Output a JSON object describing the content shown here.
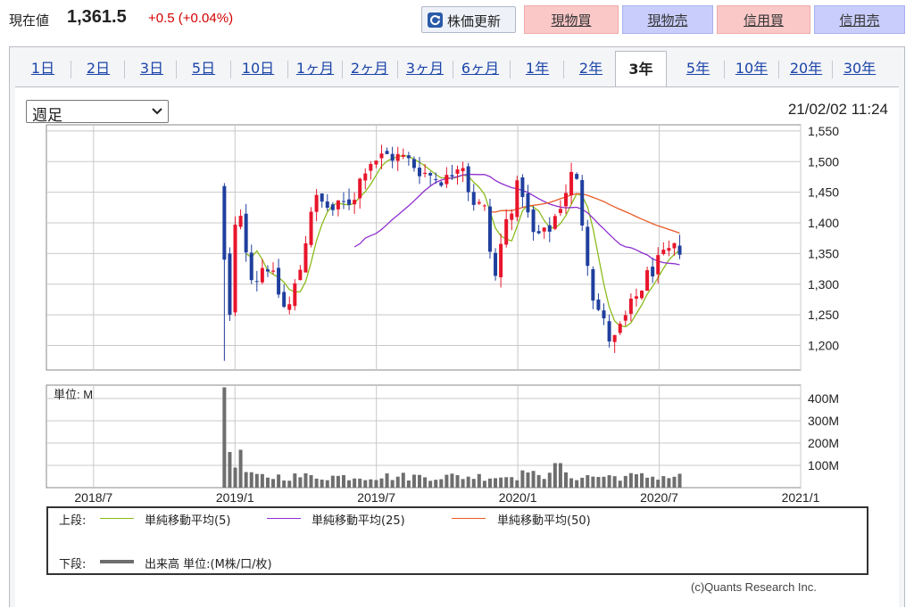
{
  "quote": {
    "label": "現在値",
    "price": "1,361.5",
    "change": "+0.5 (+0.04%)"
  },
  "toolbar": {
    "refresh_label": "株価更新",
    "buttons": [
      "現物買",
      "現物売",
      "信用買",
      "信用売"
    ]
  },
  "tabs": [
    "1日",
    "2日",
    "3日",
    "5日",
    "10日",
    "1ヶ月",
    "2ヶ月",
    "3ヶ月",
    "6ヶ月",
    "1年",
    "2年",
    "3年",
    "5年",
    "10年",
    "20年",
    "30年"
  ],
  "active_tab": "3年",
  "period_select": {
    "value": "週足"
  },
  "timestamp": "21/02/02 11:24",
  "volume_unit_label": "単位: M",
  "legend": {
    "upper_label": "上段:",
    "ma5": "単純移動平均(5)",
    "ma25": "単純移動平均(25)",
    "ma50": "単純移動平均(50)",
    "lower_label": "下段:",
    "volume": "出来高 単位:(M株/口/枚)"
  },
  "copyright": "(c)Quants Research Inc.",
  "colors": {
    "up": "#e8152b",
    "down": "#1f3f9e",
    "ma5": "#8cbc1c",
    "ma25": "#8f2fcf",
    "ma50": "#e85a26",
    "volume": "#6e6e6e",
    "accent_link": "#1a44a8"
  },
  "chart_data": {
    "type": "candlestick",
    "price_axis": {
      "ticks": [
        1200,
        1250,
        1300,
        1350,
        1400,
        1450,
        1500,
        1550
      ],
      "tick_labels": [
        "1,200",
        "1,250",
        "1,300",
        "1,350",
        "1,400",
        "1,450",
        "1,500",
        "1,550"
      ],
      "range": [
        1160,
        1560
      ]
    },
    "volume_axis": {
      "ticks": [
        100,
        200,
        300,
        400
      ],
      "tick_labels": [
        "100M",
        "200M",
        "300M",
        "400M"
      ],
      "range": [
        0,
        460
      ]
    },
    "x_axis": {
      "tick_labels": [
        "2018/7",
        "2019/1",
        "2019/7",
        "2020/1",
        "2020/7",
        "2021/1"
      ],
      "grid": true,
      "range_months": [
        0,
        32
      ]
    },
    "ohlc_key_points": [
      {
        "t": "2018/12",
        "o": 1460,
        "h": 1460,
        "l": 1170,
        "c": 1340
      },
      {
        "t": "2019/1",
        "o": 1340,
        "h": 1430,
        "l": 1290,
        "c": 1410
      },
      {
        "t": "2019/2",
        "o": 1330,
        "h": 1370,
        "l": 1270,
        "c": 1300
      },
      {
        "t": "2019/4",
        "o": 1290,
        "h": 1320,
        "l": 1220,
        "c": 1250
      },
      {
        "t": "2019/5",
        "o": 1340,
        "h": 1450,
        "l": 1320,
        "c": 1440
      },
      {
        "t": "2019/8",
        "o": 1440,
        "h": 1520,
        "l": 1430,
        "c": 1500
      },
      {
        "t": "2019/10",
        "o": 1520,
        "h": 1555,
        "l": 1490,
        "c": 1505
      },
      {
        "t": "2019/12",
        "o": 1490,
        "h": 1510,
        "l": 1460,
        "c": 1470
      },
      {
        "t": "2020/2",
        "o": 1490,
        "h": 1520,
        "l": 1460,
        "c": 1510
      },
      {
        "t": "2020/3",
        "o": 1440,
        "h": 1450,
        "l": 1290,
        "c": 1300
      },
      {
        "t": "2020/5",
        "o": 1330,
        "h": 1420,
        "l": 1320,
        "c": 1400
      },
      {
        "t": "2020/8",
        "o": 1420,
        "h": 1500,
        "l": 1410,
        "c": 1490
      },
      {
        "t": "2020/9",
        "o": 1400,
        "h": 1420,
        "l": 1260,
        "c": 1280
      },
      {
        "t": "2020/10",
        "o": 1230,
        "h": 1260,
        "l": 1170,
        "c": 1200
      },
      {
        "t": "2020/12",
        "o": 1280,
        "h": 1340,
        "l": 1260,
        "c": 1320
      },
      {
        "t": "2021/1",
        "o": 1340,
        "h": 1385,
        "l": 1330,
        "c": 1362
      }
    ],
    "series": [
      {
        "name": "単純移動平均(5)",
        "values_key_points": [
          [
            1,
            1360
          ],
          [
            3,
            1270
          ],
          [
            5,
            1420
          ],
          [
            8,
            1490
          ],
          [
            11,
            1470
          ],
          [
            14,
            1480
          ],
          [
            15,
            1400
          ],
          [
            17,
            1360
          ],
          [
            19,
            1450
          ],
          [
            21,
            1300
          ],
          [
            22,
            1200
          ],
          [
            24,
            1290
          ],
          [
            25,
            1330
          ],
          [
            26,
            1350
          ]
        ]
      },
      {
        "name": "単純移動平均(25)",
        "values_key_points": [
          [
            6,
            1350
          ],
          [
            7.5,
            1360
          ],
          [
            9.5,
            1440
          ],
          [
            11.5,
            1485
          ],
          [
            13,
            1490
          ],
          [
            15,
            1475
          ],
          [
            17,
            1440
          ],
          [
            19,
            1400
          ],
          [
            20,
            1380
          ],
          [
            22,
            1340
          ],
          [
            24,
            1325
          ],
          [
            26,
            1300
          ]
        ]
      },
      {
        "name": "単純移動平均(50)",
        "values_key_points": [
          [
            11.8,
            1415
          ],
          [
            13,
            1425
          ],
          [
            14.5,
            1450
          ],
          [
            17,
            1460
          ],
          [
            19,
            1450
          ],
          [
            21,
            1420
          ],
          [
            23,
            1380
          ],
          [
            25.5,
            1360
          ]
        ]
      },
      {
        "name": "出来高",
        "values_key_points": [
          [
            0,
            450
          ],
          [
            0.5,
            160
          ],
          [
            1,
            170
          ],
          [
            1.5,
            60
          ],
          [
            3,
            40
          ],
          [
            5,
            70
          ],
          [
            8,
            30
          ],
          [
            12,
            40
          ],
          [
            14,
            60
          ],
          [
            16,
            65
          ],
          [
            18,
            50
          ],
          [
            20,
            60
          ],
          [
            21.3,
            380
          ],
          [
            21.7,
            300
          ],
          [
            22.5,
            60
          ],
          [
            24,
            60
          ],
          [
            26,
            30
          ]
        ]
      }
    ]
  }
}
